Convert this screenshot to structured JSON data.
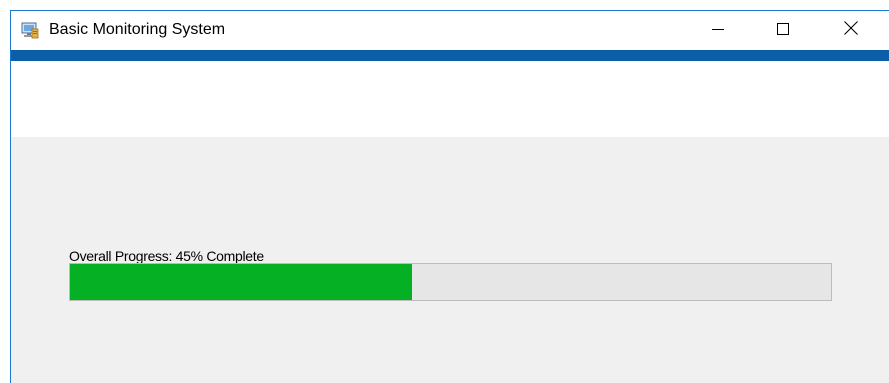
{
  "window": {
    "title": "Basic Monitoring System",
    "app_icon": "monitoring-app-icon",
    "controls": {
      "minimize_icon": "minimize-icon",
      "maximize_icon": "maximize-icon",
      "close_icon": "close-icon"
    }
  },
  "progress": {
    "label": "Overall Progress: 45% Complete",
    "value_percent": 45
  },
  "colors": {
    "accent": "#0b5ea8",
    "progress_fill": "#06b025",
    "progress_track": "#e6e6e6",
    "content_background": "#f0f0f0"
  }
}
